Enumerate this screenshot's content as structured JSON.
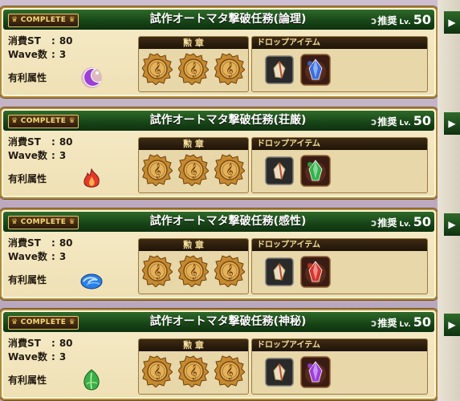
{
  "common": {
    "complete_label": "COMPLETE",
    "recommend_label": "推奨",
    "level_prefix": "Lv.",
    "stamina_label": "消費ST",
    "wave_label": "Wave数",
    "advantage_label": "有利属性",
    "colon": ":",
    "medal_label": "勲 章",
    "drop_label": "ドロップアイテム",
    "side_tab_glyph": "▶"
  },
  "colors": {
    "header_green": "#174416",
    "panel_cream": "#f2e4bb",
    "gold_border": "#b08a3c"
  },
  "missions": [
    {
      "title": "試作オートマタ撃破任務(論理)",
      "level": "50",
      "stamina": "80",
      "waves": "3",
      "attribute_icon": "purple-moon-icon",
      "attribute_color": "#9b3fd6",
      "drop_icon": "purple-crystal-drop-icon",
      "drop_color": "#3a6fe0",
      "medals": 3
    },
    {
      "title": "試作オートマタ撃破任務(荘厳)",
      "level": "50",
      "stamina": "80",
      "waves": "3",
      "attribute_icon": "red-flame-icon",
      "attribute_color": "#e5382a",
      "drop_icon": "green-crystal-drop-icon",
      "drop_color": "#2fb34a",
      "medals": 3
    },
    {
      "title": "試作オートマタ撃破任務(感性)",
      "level": "50",
      "stamina": "80",
      "waves": "3",
      "attribute_icon": "blue-wave-icon",
      "attribute_color": "#2b7fe8",
      "drop_icon": "red-crystal-drop-icon",
      "drop_color": "#d8342a",
      "medals": 3
    },
    {
      "title": "試作オートマタ撃破任務(神秘)",
      "level": "50",
      "stamina": "80",
      "waves": "3",
      "attribute_icon": "green-leaf-icon",
      "attribute_color": "#38b048",
      "drop_icon": "purple-crystal-drop-icon",
      "drop_color": "#9d3ee0",
      "medals": 3
    }
  ]
}
